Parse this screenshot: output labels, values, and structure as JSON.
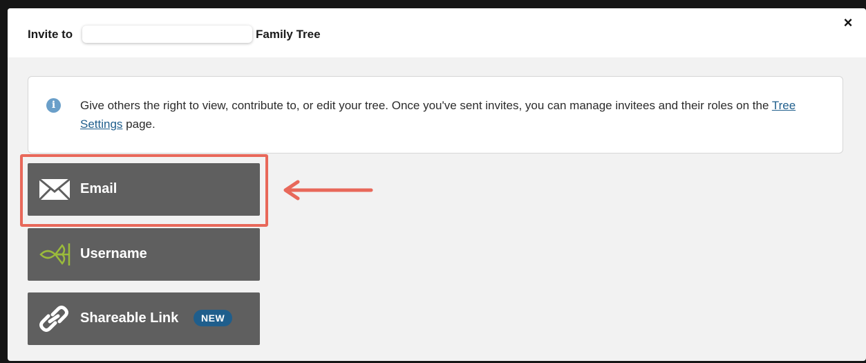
{
  "dialog": {
    "title_prefix": "Invite to",
    "title_suffix": "Family Tree",
    "close_label": "×"
  },
  "info": {
    "text_before": "Give others the right to view, contribute to, or edit your tree. Once you've sent invites, you can manage invitees and their roles on the ",
    "link_text": "Tree Settings",
    "text_after": " page."
  },
  "options": [
    {
      "label": "Email",
      "icon": "envelope-icon"
    },
    {
      "label": "Username",
      "icon": "ancestry-leaf-icon"
    },
    {
      "label": "Shareable Link",
      "icon": "link-icon",
      "badge": "NEW"
    }
  ],
  "colors": {
    "button_bg": "#5f5f5f",
    "badge_bg": "#1f5e8c",
    "highlight": "#e8685a",
    "leaf": "#9bbb3b",
    "info_icon": "#6a9fc9"
  }
}
